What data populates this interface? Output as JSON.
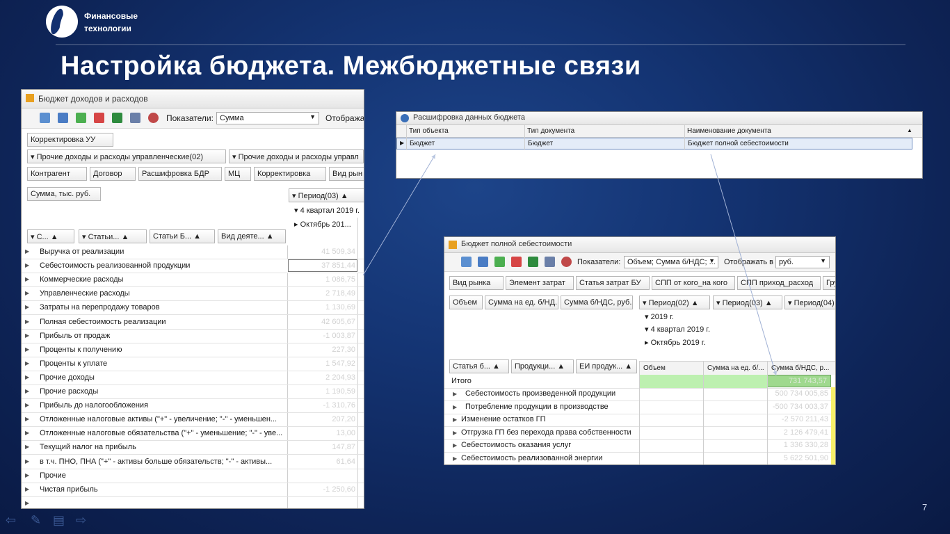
{
  "slide": {
    "brand_line1": "Финансовые",
    "brand_line2": "технологии",
    "title": "Настройка бюджета. Межбюджетные связи",
    "page_number": "7"
  },
  "win1": {
    "title": "Бюджет доходов и расходов",
    "indicators_label": "Показатели:",
    "indicators_value": "Сумма",
    "display_label": "Отобража",
    "filter_chip": "Корректировка УУ",
    "group_chip1": "Прочие доходы и расходы управленческие(02)",
    "group_chip2": "Прочие доходы и расходы управл",
    "fields": [
      "Контрагент",
      "Договор",
      "Расшифровка БДР",
      "МЦ",
      "Корректировка",
      "Вид рын"
    ],
    "data_field": "Сумма, тыс. руб.",
    "col_period": "Период(03)",
    "col_quarter": "4 квартал 2019 г.",
    "col_month": "Октябрь 201...",
    "row_headers": [
      "С...",
      "Статьи...",
      "Статьи Б...",
      "Вид деяте..."
    ],
    "rows": [
      {
        "label": "Выручка от реализации",
        "value": "41 509,34"
      },
      {
        "label": "Себестоимость реализованной продукции",
        "value": "37 851,44"
      },
      {
        "label": "Коммерческие расходы",
        "value": "1 086,75"
      },
      {
        "label": "Управленческие расходы",
        "value": "2 718,49"
      },
      {
        "label": "Затраты на перепродажу товаров",
        "value": "1 130,69"
      },
      {
        "label": "Полная себестоимость реализации",
        "value": "42 605,67"
      },
      {
        "label": "Прибыль от продаж",
        "value": "-1 003,87"
      },
      {
        "label": "Проценты к получению",
        "value": "227,30"
      },
      {
        "label": "Проценты к уплате",
        "value": "1 547,92"
      },
      {
        "label": "Прочие доходы",
        "value": "2 204,93"
      },
      {
        "label": "Прочие расходы",
        "value": "1 190,59"
      },
      {
        "label": "Прибыль до налогообложения",
        "value": "-1 310,76"
      },
      {
        "label": "Отложенные налоговые активы  (\"+\" - увеличение; \"-\" - уменьшен...",
        "value": "207,20"
      },
      {
        "label": "Отложенные налоговые обязательства (\"+\" - уменьшение; \"-\" - уве...",
        "value": "13,00"
      },
      {
        "label": "Текущий налог на прибыль",
        "value": "147,87"
      },
      {
        "label": "  в т.ч. ПНО, ПНА (\"+\" - активы больше обязательств; \"-\" - активы...",
        "value": "61,64"
      },
      {
        "label": "Прочие",
        "value": ""
      },
      {
        "label": "Чистая прибыль",
        "value": "-1 250,60"
      },
      {
        "label": "",
        "value": ""
      }
    ]
  },
  "win2": {
    "title": "Расшифровка данных бюджета",
    "columns": [
      "Тип объекта",
      "Тип документа",
      "Наименование документа"
    ],
    "row": [
      "Бюджет",
      "Бюджет",
      "Бюджет полной себестоимости"
    ]
  },
  "win3": {
    "title": "Бюджет полной себестоимости",
    "indicators_label": "Показатели:",
    "indicators_value": "Объем; Сумма б/НДС; ...",
    "display_label": "Отображать в",
    "display_value": "руб.",
    "fields": [
      "Вид рынка",
      "Элемент затрат",
      "Статья затрат БУ",
      "СПП от кого_на кого",
      "СПП приход_расход",
      "Гру"
    ],
    "data_fields": [
      "Объем",
      "Сумма на ед. б/НД...",
      "Сумма б/НДС, руб."
    ],
    "periods": [
      "Период(02)",
      "Период(03)",
      "Период(04)"
    ],
    "year": "2019 г.",
    "quarter": "4 квартал 2019 г.",
    "month": "Октябрь 2019 г.",
    "row_headers": [
      "Статья б...",
      "Продукци...",
      "ЕИ продук..."
    ],
    "col_headers": [
      "Объем",
      "Сумма на ед. б/...",
      "Сумма б/НДС, р..."
    ],
    "total_label": "Итого",
    "total_value": "731 743,57",
    "rows": [
      {
        "label": "Себестоимость произведенной продукции",
        "value": "500 734 005,85"
      },
      {
        "label": "Потребление продукции в производстве",
        "value": "-500 734 003,37"
      },
      {
        "label": "Изменение остатков ГП",
        "value": "-2 570 211,43"
      },
      {
        "label": "Отгрузка ГП без перехода права собственности",
        "value": "2 126 479,41"
      },
      {
        "label": "Себестоимость оказания услуг",
        "value": "1 336 330,28"
      },
      {
        "label": "Себестоимость реализованной энергии",
        "value": "5 622 501,90"
      }
    ]
  }
}
